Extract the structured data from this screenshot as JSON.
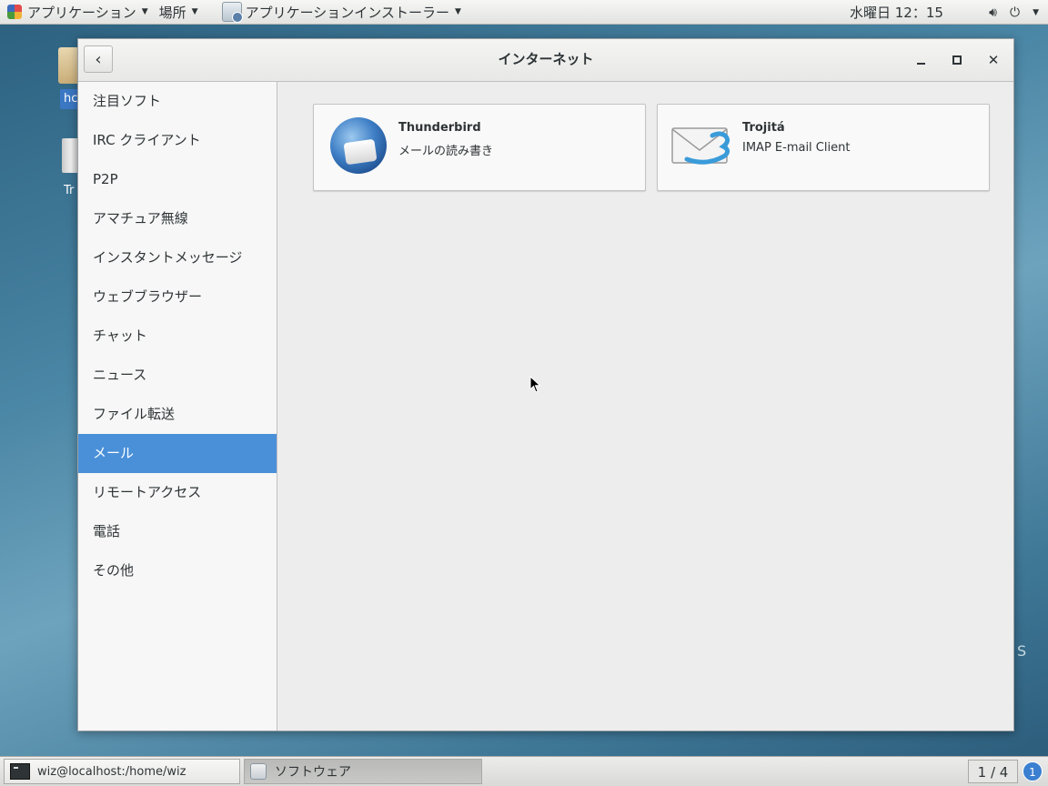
{
  "topbar": {
    "applications_label": "アプリケーション",
    "places_label": "場所",
    "active_app_label": "アプリケーションインストーラー",
    "clock": "水曜日  12：15"
  },
  "desktop": {
    "home_label": "hc",
    "trash_label": "Tr",
    "wallpaper_text": "S"
  },
  "window": {
    "title": "インターネット",
    "sidebar": {
      "items": [
        {
          "label": "注目ソフト",
          "active": false
        },
        {
          "label": "IRC クライアント",
          "active": false
        },
        {
          "label": "P2P",
          "active": false
        },
        {
          "label": "アマチュア無線",
          "active": false
        },
        {
          "label": "インスタントメッセージ",
          "active": false
        },
        {
          "label": "ウェブブラウザー",
          "active": false
        },
        {
          "label": "チャット",
          "active": false
        },
        {
          "label": "ニュース",
          "active": false
        },
        {
          "label": "ファイル転送",
          "active": false
        },
        {
          "label": "メール",
          "active": true
        },
        {
          "label": "リモートアクセス",
          "active": false
        },
        {
          "label": "電話",
          "active": false
        },
        {
          "label": "その他",
          "active": false
        }
      ]
    },
    "apps": [
      {
        "name": "Thunderbird",
        "summary": "メールの読み書き",
        "icon": "thunderbird-logo-icon"
      },
      {
        "name": "Trojitá",
        "summary": "IMAP E-mail Client",
        "icon": "trojita-envelope-icon"
      }
    ]
  },
  "taskbar": {
    "terminal_task": "wiz@localhost:/home/wiz",
    "software_task": "ソフトウェア",
    "workspace": "1 / 4",
    "notification_count": "1"
  },
  "colors": {
    "selection": "#4a90d9",
    "sidebar_bg": "#f7f7f7",
    "content_bg": "#ededed"
  }
}
